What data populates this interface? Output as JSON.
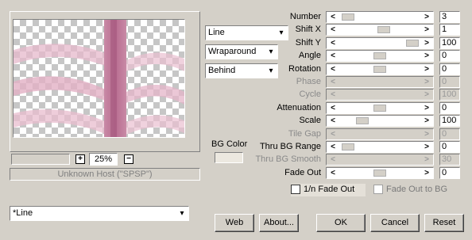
{
  "preview": {
    "zoom": "25%",
    "zoom_in": "+",
    "zoom_out": "−",
    "host": "Unknown Host (\"SPSP\")"
  },
  "combos": {
    "shape": "Line",
    "mode": "Wraparound",
    "layer": "Behind",
    "preset": "*Line"
  },
  "bg_color_label": "BG Color",
  "params": [
    {
      "label": "Number",
      "value": "3",
      "level": 0.05,
      "enabled": true
    },
    {
      "label": "Shift X",
      "value": "1",
      "level": 0.55,
      "enabled": true
    },
    {
      "label": "Shift Y",
      "value": "100",
      "level": 0.95,
      "enabled": true
    },
    {
      "label": "Angle",
      "value": "0",
      "level": 0.5,
      "enabled": true
    },
    {
      "label": "Rotation",
      "value": "0",
      "level": 0.5,
      "enabled": true
    },
    {
      "label": "Phase",
      "value": "0",
      "level": 0.0,
      "enabled": false
    },
    {
      "label": "Cycle",
      "value": "100",
      "level": 0.0,
      "enabled": false
    },
    {
      "label": "Attenuation",
      "value": "0",
      "level": 0.5,
      "enabled": true
    },
    {
      "label": "Scale",
      "value": "100",
      "level": 0.25,
      "enabled": true
    },
    {
      "label": "Tile Gap",
      "value": "0",
      "level": 0.0,
      "enabled": false
    },
    {
      "label": "Thru BG Range",
      "value": "0",
      "level": 0.05,
      "enabled": true
    },
    {
      "label": "Thru BG Smooth",
      "value": "30",
      "level": 0.0,
      "enabled": false
    },
    {
      "label": "Fade Out",
      "value": "0",
      "level": 0.5,
      "enabled": true
    }
  ],
  "checks": {
    "fade_out_1n": "1/n Fade Out",
    "fade_out_bg": "Fade Out to BG"
  },
  "buttons": {
    "web": "Web",
    "about": "About...",
    "ok": "OK",
    "cancel": "Cancel",
    "reset": "Reset"
  },
  "arrows": {
    "left": "<",
    "right": ">",
    "down": "▾"
  }
}
